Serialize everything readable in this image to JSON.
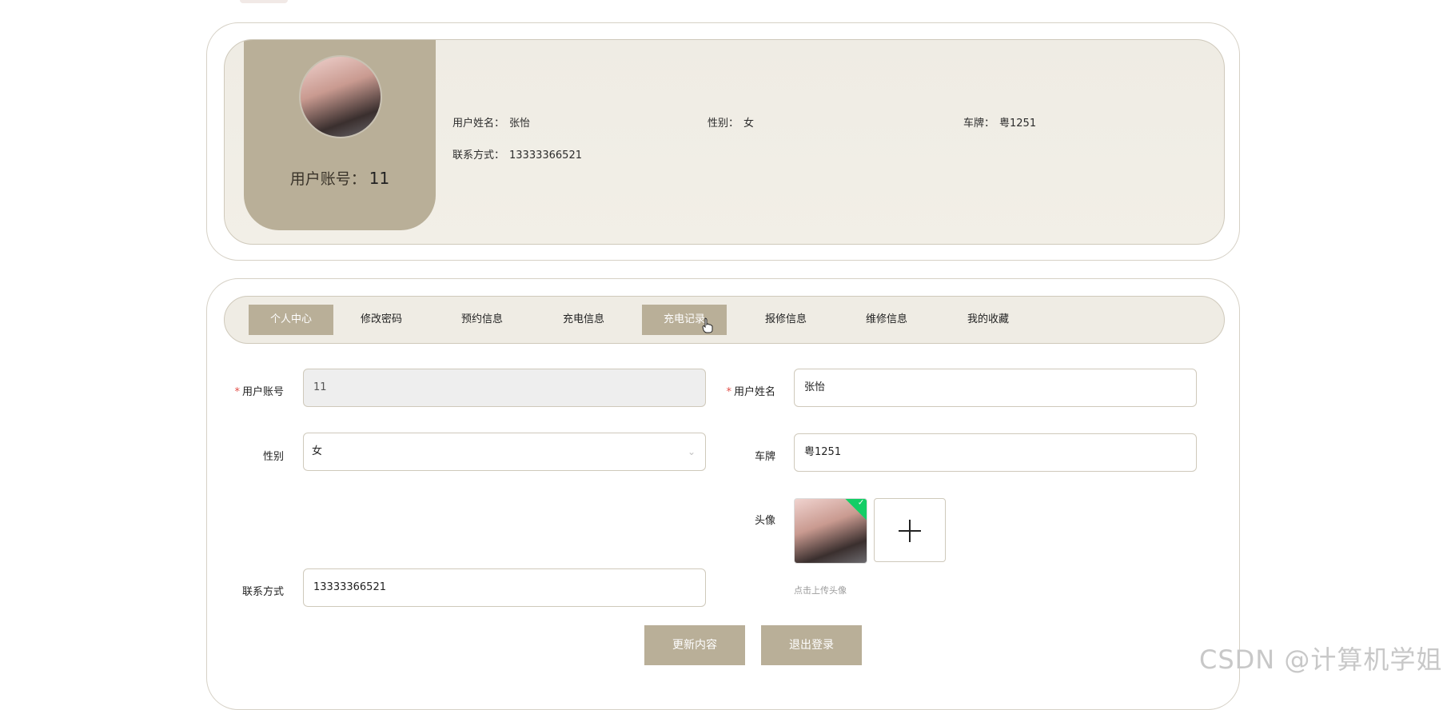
{
  "profile": {
    "account_label": "用户账号：",
    "account_value": "11",
    "fields": [
      {
        "label": "用户姓名：",
        "value": "张怡"
      },
      {
        "label": "性别：",
        "value": "女"
      },
      {
        "label": "车牌：",
        "value": "粤1251"
      },
      {
        "label": "联系方式：",
        "value": "13333366521"
      }
    ]
  },
  "tabs": [
    {
      "label": "个人中心",
      "state": "active"
    },
    {
      "label": "修改密码",
      "state": "normal"
    },
    {
      "label": "预约信息",
      "state": "normal"
    },
    {
      "label": "充电信息",
      "state": "normal"
    },
    {
      "label": "充电记录",
      "state": "hover"
    },
    {
      "label": "报修信息",
      "state": "normal"
    },
    {
      "label": "维修信息",
      "state": "normal"
    },
    {
      "label": "我的收藏",
      "state": "normal"
    }
  ],
  "form": {
    "account": {
      "required_mark": "*",
      "label": "用户账号",
      "value": "11"
    },
    "name": {
      "required_mark": "*",
      "label": "用户姓名",
      "value": "张怡"
    },
    "gender": {
      "label": "性别",
      "value": "女"
    },
    "plate": {
      "label": "车牌",
      "value": "粤1251"
    },
    "avatar": {
      "label": "头像",
      "hint": "点击上传头像"
    },
    "phone": {
      "label": "联系方式",
      "value": "13333366521"
    }
  },
  "buttons": {
    "update": "更新内容",
    "logout": "退出登录"
  },
  "watermark": "CSDN @计算机学姐",
  "colors": {
    "accent": "#b9af98",
    "panel_bg": "#efece4",
    "required": "#e2504a",
    "upload_success": "#13ce66"
  }
}
